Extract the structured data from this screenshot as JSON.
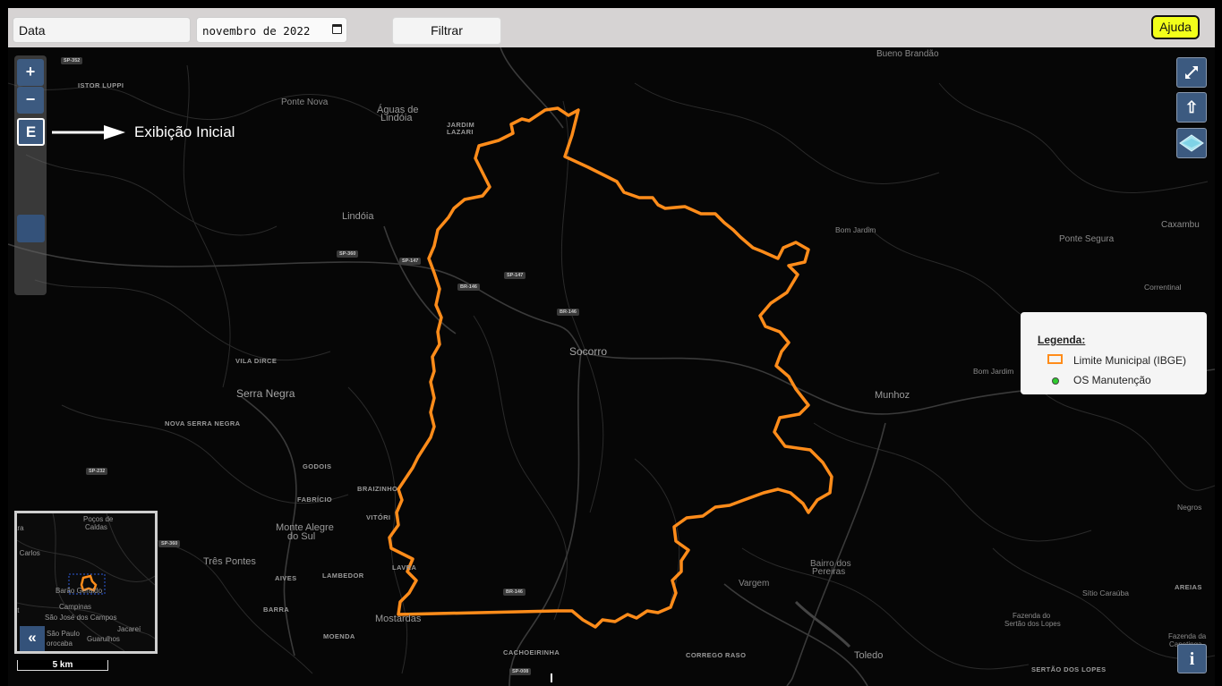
{
  "toolbar": {
    "date_label": "Data",
    "month_value": "novembro de 2022",
    "filter_label": "Filtrar",
    "help_label": "Ajuda"
  },
  "controls": {
    "zoom_in": "+",
    "zoom_out": "−",
    "initial_view": "E",
    "initial_view_caption": "Exibição Inicial",
    "fullscreen_icon": "↗↙",
    "up_icon": "⇧",
    "info": "i",
    "collapse": "«"
  },
  "legend": {
    "title": "Legenda:",
    "items": [
      {
        "label": "Limite Municipal (IBGE)",
        "color": "#ff8c1a",
        "icon": "orange-outline-square"
      },
      {
        "label": "OS Manutenção",
        "color": "#2ecc2e",
        "icon": "green-dot"
      }
    ]
  },
  "scale_label": "5 km",
  "places": {
    "bueno_brandao": "Bueno Brandão",
    "ponte_nova": "Ponte Nova",
    "aguas_lindoia": "Águas de",
    "aguas_lindoia_2": "Lindóia",
    "jardim_lazari": "JARDIM",
    "jardim_lazari_2": "LAZARI",
    "lindoia": "Lindóia",
    "istor_luppi": "ISTOR LUPPI",
    "vila_dirce": "VILA DIRCE",
    "serra_negra": "Serra Negra",
    "nova_serra_negra": "NOVA SERRA NEGRA",
    "socorro": "Socorro",
    "godois": "GODOIS",
    "fabricio": "FABRÍCIO",
    "braizinho": "BRAIZINHO",
    "vitoria": "VITÓRI",
    "monte_alegre": "Monte Alegre",
    "monte_alegre_2": "do Sul",
    "tres_pontes": "Três Pontes",
    "aives": "AIVES",
    "lambedor": "LAMBEDOR",
    "lavras": "LAVRA",
    "barra": "BARRA",
    "mostardas": "Mostardas",
    "moenda": "MOENDA",
    "cachoeirinha": "CACHOEIRINHA",
    "corrego_raso": "CORREGO RASO",
    "toledo": "Toledo",
    "vargem": "Vargem",
    "bairro_pereiras": "Bairro dos",
    "bairro_pereiras_2": "Pereiras",
    "munhoz": "Munhoz",
    "bom_jardim": "Bom Jardim",
    "bom_jardim_2": "Bom Jardim",
    "ponte_segura": "Ponte Segura",
    "caxambu": "Caxambu",
    "correntinal": "Correntinal",
    "negros": "Negros",
    "areias": "AREIAS",
    "sitio_caraiba": "Sítio Caraúba",
    "fazenda_sertao": "Fazenda do",
    "fazenda_sertao_2": "Sertão dos Lopes",
    "fazenda_capetinga": "Fazenda da",
    "fazenda_capetinga_2": "Capetinga",
    "sertao_lopes": "SERTÃO DOS LOPES"
  },
  "shields": {
    "sp352": "SP-352",
    "sp360a": "SP-360",
    "sp147a": "SP-147",
    "br146a": "BR-146",
    "sp147b": "SP-147",
    "br146b": "BR-146",
    "sp232": "SP-232",
    "sp360b": "SP-360",
    "br146c": "BR-146",
    "sp008": "SP-008"
  },
  "overview": {
    "pocos": "Poços de",
    "pocos_2": "Caldas",
    "carlos": "n Carlos",
    "barao": "Barão Geraldo",
    "campinas": "Campinas",
    "sjc": "São José dos Campos",
    "sao_paulo": "São Paulo",
    "sorocaba": "orocaba",
    "guarulhos": "Guarulhos",
    "jacarei": "Jacareí",
    "ara": "ara",
    "lat": "lat"
  }
}
